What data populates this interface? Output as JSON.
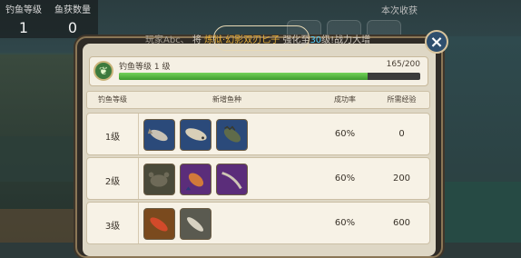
{
  "hud": {
    "fishing_level_label": "钓鱼等级",
    "fishing_level_value": "1",
    "fish_count_label": "鱼获数量",
    "fish_count_value": "0",
    "harvest_label": "本次收获"
  },
  "notice": {
    "prefix": "玩家Abc、",
    "verb": "将",
    "item": "炼狱·幻影双刃匕子",
    "mid": "强化至",
    "level": "30",
    "suffix": "级!战力大增"
  },
  "level_panel": {
    "label": "钓鱼等级  1  级",
    "progress_text": "165/200",
    "progress": 0.825
  },
  "table": {
    "headers": [
      "钓鱼等级",
      "新增鱼种",
      "成功率",
      "所需经验"
    ],
    "rows": [
      {
        "level": "1级",
        "rate": "60%",
        "exp": "0",
        "fish": [
          "silver-fish-icon",
          "flatfish-icon",
          "spiny-fish-icon"
        ]
      },
      {
        "level": "2级",
        "rate": "60%",
        "exp": "200",
        "fish": [
          "crab-icon",
          "purple-fish-icon",
          "eel-icon"
        ]
      },
      {
        "level": "3级",
        "rate": "60%",
        "exp": "600",
        "fish": [
          "red-fish-icon",
          "silver-fish-icon"
        ]
      }
    ]
  },
  "close_icon": "close-icon"
}
